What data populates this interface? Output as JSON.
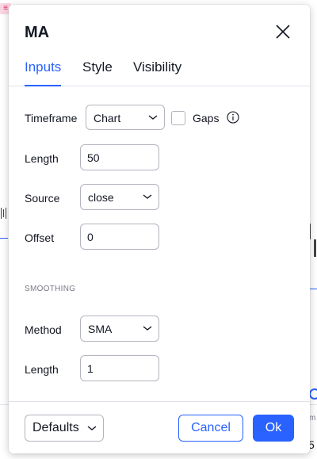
{
  "dialog": {
    "title": "MA",
    "tabs": [
      {
        "label": "Inputs",
        "active": true
      },
      {
        "label": "Style",
        "active": false
      },
      {
        "label": "Visibility",
        "active": false
      }
    ]
  },
  "inputs": {
    "timeframe": {
      "label": "Timeframe",
      "value": "Chart"
    },
    "gaps": {
      "label": "Gaps",
      "checked": false
    },
    "length": {
      "label": "Length",
      "value": "50"
    },
    "source": {
      "label": "Source",
      "value": "close"
    },
    "offset": {
      "label": "Offset",
      "value": "0"
    }
  },
  "smoothing": {
    "section_label": "SMOOTHING",
    "method": {
      "label": "Method",
      "value": "SMA"
    },
    "length": {
      "label": "Length",
      "value": "1"
    }
  },
  "footer": {
    "defaults_label": "Defaults",
    "cancel_label": "Cancel",
    "ok_label": "Ok"
  },
  "background": {
    "digit": "5",
    "letter": "m"
  },
  "colors": {
    "accent": "#2962ff",
    "text": "#131722",
    "border": "#b2b5be",
    "muted": "#787b86"
  }
}
